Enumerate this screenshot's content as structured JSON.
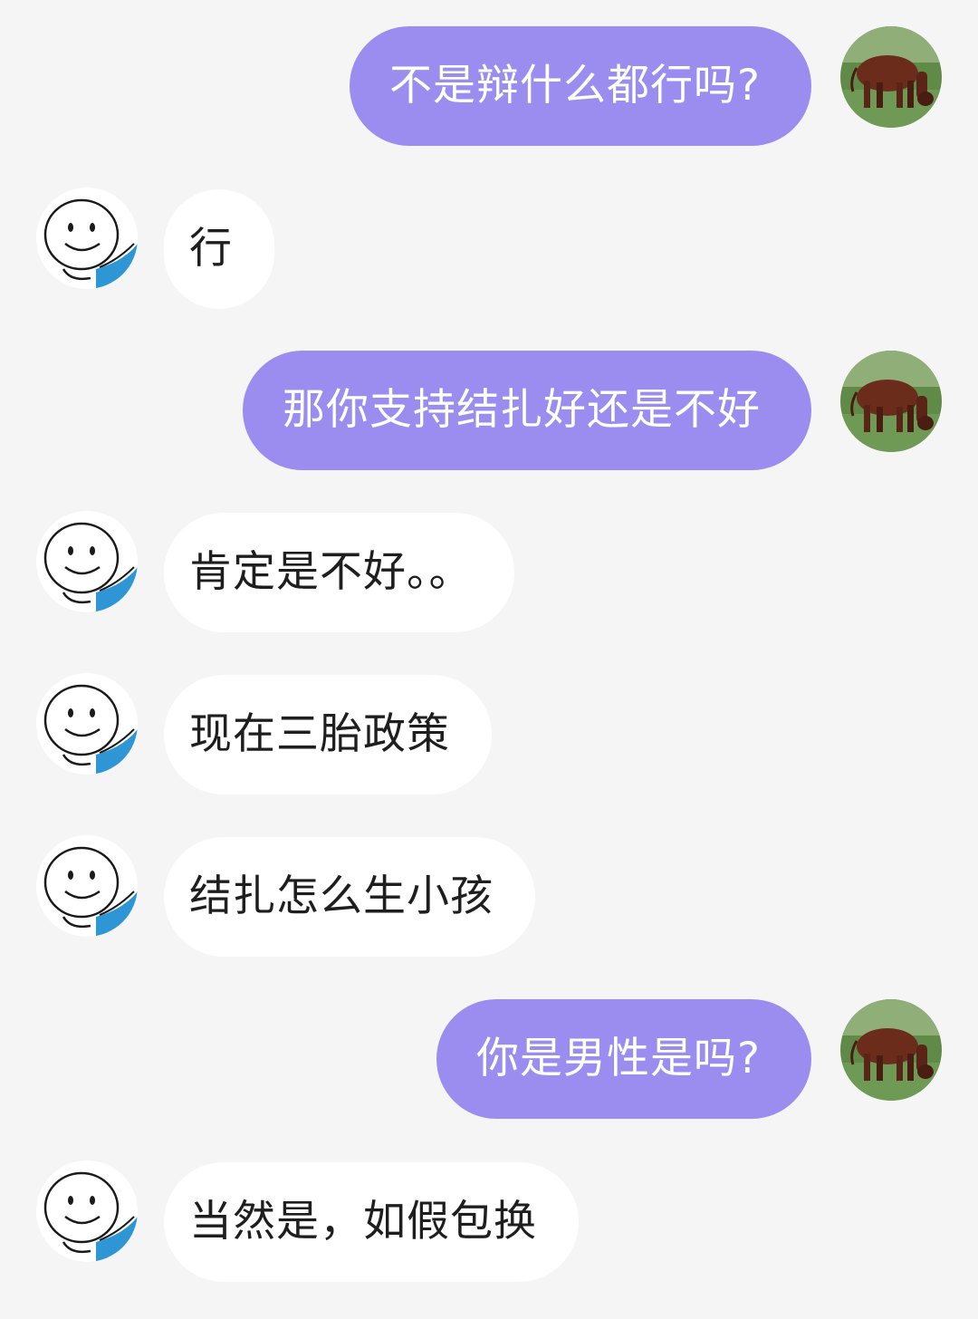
{
  "messages": [
    {
      "sender": "me",
      "text": "不是辩什么都行吗?"
    },
    {
      "sender": "other",
      "text": "行"
    },
    {
      "sender": "me",
      "text": "那你支持结扎好还是不好"
    },
    {
      "sender": "other",
      "text": "肯定是不好。。"
    },
    {
      "sender": "other",
      "text": "现在三胎政策"
    },
    {
      "sender": "other",
      "text": "结扎怎么生小孩"
    },
    {
      "sender": "me",
      "text": "你是男性是吗?"
    },
    {
      "sender": "other",
      "text": "当然是，如假包换"
    }
  ],
  "colors": {
    "background": "#f5f5f5",
    "my_bubble": "#9b8cf0",
    "their_bubble": "#ffffff"
  },
  "avatars": {
    "me": "cow-avatar-icon",
    "other": "smiley-face-avatar-icon"
  }
}
